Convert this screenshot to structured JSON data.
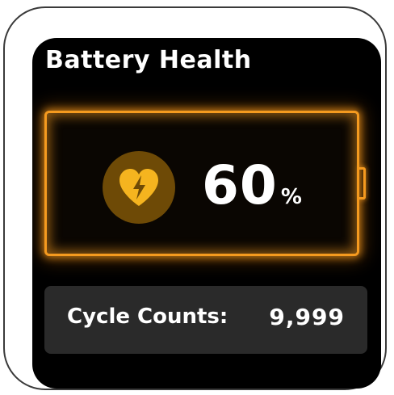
{
  "header": {
    "title": "Battery Health"
  },
  "battery": {
    "health_value": "60",
    "unit": "%",
    "level_fraction": 0.6,
    "icon": "heart-bolt-icon",
    "accent_color": "#f59a1f",
    "icon_color": "#f5b41f"
  },
  "cycles": {
    "label": "Cycle Counts:",
    "value": "9,999"
  }
}
